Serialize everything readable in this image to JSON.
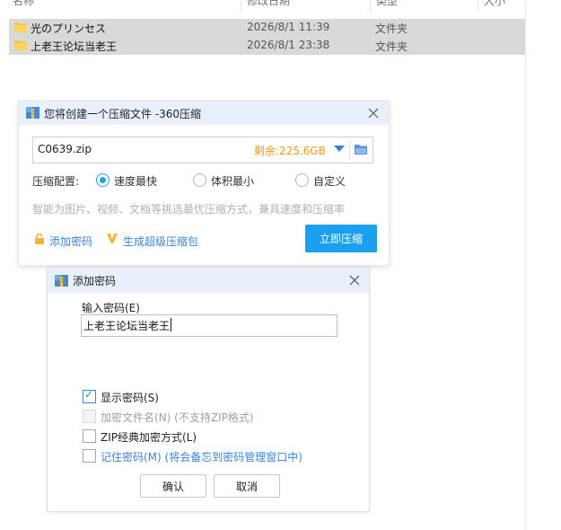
{
  "explorer": {
    "headers": {
      "name": "名称",
      "modified": "修改日期",
      "type": "类型",
      "size": "大小"
    },
    "files": [
      {
        "name": "光のプリンセス",
        "date": "2026/8/1 11:39",
        "type": "文件夹"
      },
      {
        "name": "上老王论坛当老王",
        "date": "2026/8/1 23:38",
        "type": "文件夹"
      }
    ]
  },
  "compress_dialog": {
    "title": "您将创建一个压缩文件 -360压缩",
    "filename": "C0639.zip",
    "free_space": "剩余:225.6GB",
    "config_label": "压缩配置:",
    "options": [
      "速度最快",
      "体积最小",
      "自定义"
    ],
    "selected_option": "速度最快",
    "hint": "智能为图片、视频、文档等挑选最优压缩方式，兼具速度和压缩率",
    "add_password_link": "添加密码",
    "super_archive_link": "生成超级压缩包",
    "compress_button": "立即压缩",
    "colors": {
      "accent": "#1aa0ef",
      "free_space": "#e89b1b",
      "link": "#3a83d6"
    }
  },
  "password_dialog": {
    "title": "添加密码",
    "input_label": "输入密码(E)",
    "password_value": "上老王论坛当老王",
    "checkboxes": [
      {
        "label": "显示密码(S)",
        "checked": true,
        "disabled": false
      },
      {
        "label": "加密文件名(N) (不支持ZIP格式)",
        "checked": false,
        "disabled": true
      },
      {
        "label": "ZIP经典加密方式(L)",
        "checked": false,
        "disabled": false
      },
      {
        "label": "记住密码(M) (将会备忘到密码管理窗口中)",
        "checked": false,
        "disabled": false
      }
    ],
    "ok_button": "确认",
    "cancel_button": "取消"
  }
}
